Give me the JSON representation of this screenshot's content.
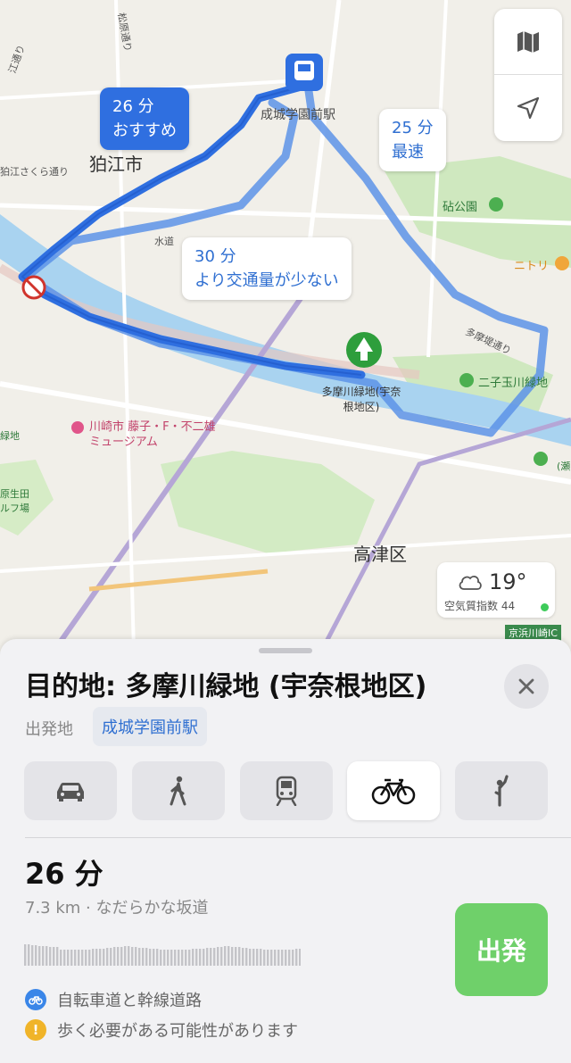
{
  "map": {
    "route_labels": {
      "recommended_time": "26 分",
      "recommended_tag": "おすすめ",
      "fastest_time": "25 分",
      "fastest_tag": "最速",
      "less_traffic_time": "30 分",
      "less_traffic_tag": "より交通量が少ない"
    },
    "places": {
      "komae": "狛江市",
      "station": "成城学園前駅",
      "kinuta_park": "砧公園",
      "nitori": "ニトリ",
      "futako": "二子玉川緑地",
      "tamagawa_park": "多摩川緑地(宇奈根地区)",
      "kawasaki_museum": "川崎市 藤子・F・不二雄ミュージアム",
      "takatsu": "高津区",
      "komae_sakura": "狛江さくら通り",
      "matsubara": "松原通り",
      "tamazutsumi": "多摩堤通り",
      "suido": "水道",
      "edo_dori": "江通り",
      "keihin": "京浜川崎IC",
      "ryokuchi": "緑地",
      "golf": "原生田\nルフ場",
      "seta": "(瀬"
    },
    "controls": {
      "map_icon": "map-icon",
      "location_icon": "location-arrow-icon"
    },
    "weather": {
      "temp": "19°",
      "aqi": "空気質指数 44",
      "aqi_color": "#3ecb5a"
    },
    "route_color": "#2f6fe0"
  },
  "sheet": {
    "title": "目的地: 多摩川緑地 (宇奈根地区)",
    "origin_label": "出発地",
    "origin_value": "成城学園前駅",
    "modes": [
      "car",
      "walk",
      "transit",
      "cycle",
      "rideshare"
    ],
    "active_mode": "cycle",
    "route": {
      "time": "26 分",
      "details": "7.3 km · なだらかな坂道",
      "go_label": "出発"
    },
    "notes": [
      {
        "icon": "bicycle-icon",
        "color": "#3a86e8",
        "text": "自転車道と幹線道路"
      },
      {
        "icon": "warning-icon",
        "color": "#f0b429",
        "text": "歩く必要がある可能性があります"
      }
    ]
  }
}
